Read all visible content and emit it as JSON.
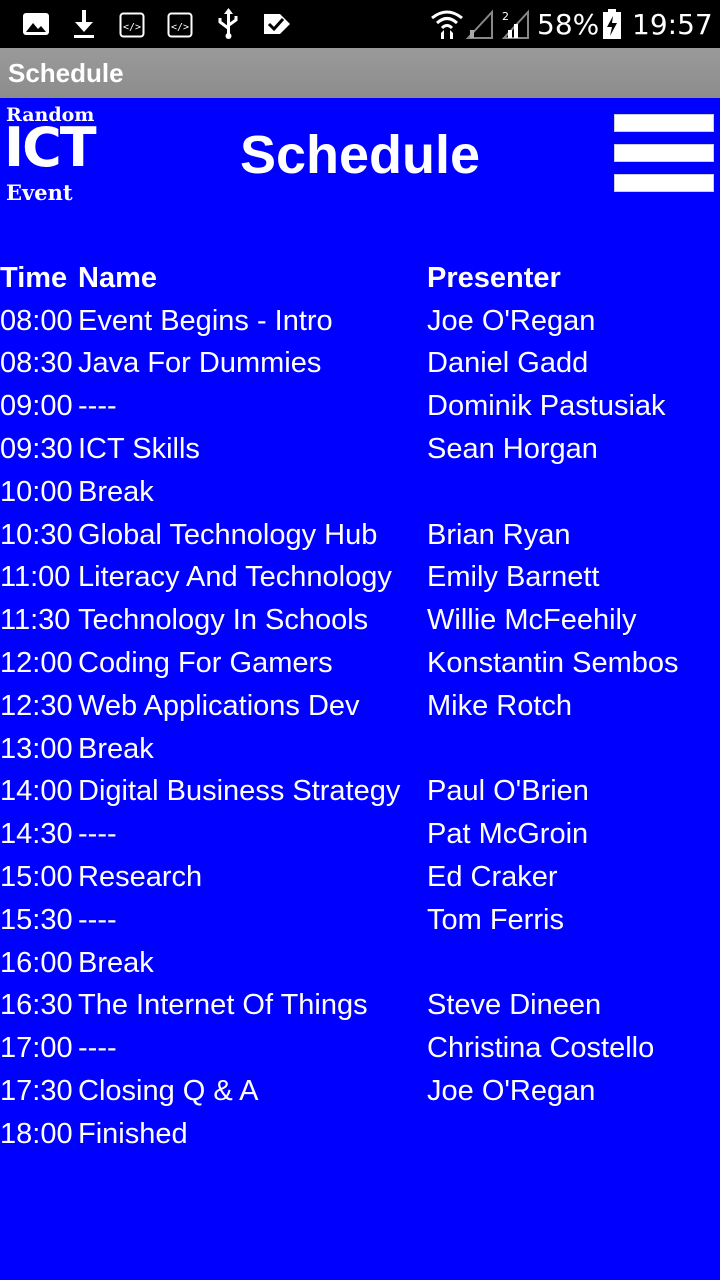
{
  "status_bar": {
    "battery": "58%",
    "time": "19:57",
    "icons": [
      "image-icon",
      "download-icon",
      "code-icon",
      "code-icon",
      "usb-icon",
      "task-icon",
      "wifi-icon",
      "signal-icon",
      "signal-2-icon",
      "battery-icon"
    ]
  },
  "app_bar": {
    "title": "Schedule"
  },
  "header": {
    "logo_top": "Random",
    "logo_mid": "ICT",
    "logo_bottom": "Event",
    "title": "Schedule",
    "menu_icon": "hamburger-menu-icon"
  },
  "schedule": {
    "columns": [
      "Time",
      "Name",
      "Presenter"
    ],
    "rows": [
      {
        "time": "08:00",
        "name": "Event Begins - Intro",
        "presenter": "Joe O'Regan"
      },
      {
        "time": "08:30",
        "name": "Java For Dummies",
        "presenter": "Daniel Gadd"
      },
      {
        "time": "09:00",
        "name": "----",
        "presenter": "Dominik Pastusiak"
      },
      {
        "time": "09:30",
        "name": "ICT Skills",
        "presenter": "Sean Horgan"
      },
      {
        "time": "10:00",
        "name": "Break",
        "presenter": ""
      },
      {
        "time": "10:30",
        "name": "Global Technology Hub",
        "presenter": "Brian Ryan"
      },
      {
        "time": "11:00",
        "name": "Literacy And Technology",
        "presenter": "Emily Barnett"
      },
      {
        "time": "11:30",
        "name": "Technology In Schools",
        "presenter": "Willie McFeehily"
      },
      {
        "time": "12:00",
        "name": "Coding For Gamers",
        "presenter": "Konstantin Sembos"
      },
      {
        "time": "12:30",
        "name": "Web Applications Dev",
        "presenter": "Mike Rotch"
      },
      {
        "time": "13:00",
        "name": "Break",
        "presenter": ""
      },
      {
        "time": "14:00",
        "name": "Digital Business Strategy",
        "presenter": "Paul O'Brien"
      },
      {
        "time": "14:30",
        "name": "----",
        "presenter": "Pat McGroin"
      },
      {
        "time": "15:00",
        "name": "Research",
        "presenter": "Ed Craker"
      },
      {
        "time": "15:30",
        "name": "----",
        "presenter": "Tom Ferris"
      },
      {
        "time": "16:00",
        "name": "Break",
        "presenter": ""
      },
      {
        "time": "16:30",
        "name": "The Internet Of Things",
        "presenter": "Steve Dineen"
      },
      {
        "time": "17:00",
        "name": "----",
        "presenter": "Christina Costello"
      },
      {
        "time": "17:30",
        "name": "Closing Q & A",
        "presenter": "Joe O'Regan"
      },
      {
        "time": "18:00",
        "name": "Finished",
        "presenter": ""
      }
    ]
  },
  "colors": {
    "background": "#0000FF",
    "app_bar": "#949494",
    "status_bar": "#000000",
    "text": "#FFFFFF"
  }
}
